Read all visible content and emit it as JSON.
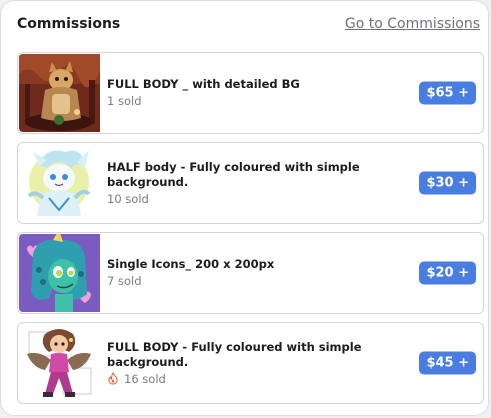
{
  "header": {
    "title": "Commissions",
    "link_label": "Go to Commissions"
  },
  "commissions": [
    {
      "name": "FULL BODY _ with detailed BG",
      "sold": "1 sold",
      "price": "$65 +",
      "hot": false
    },
    {
      "name": "HALF body - Fully coloured with simple background.",
      "sold": "10 sold",
      "price": "$30 +",
      "hot": false
    },
    {
      "name": "Single Icons_ 200 x 200px",
      "sold": "7 sold",
      "price": "$20 +",
      "hot": false
    },
    {
      "name": "FULL BODY - Fully coloured with simple background.",
      "sold": "16 sold",
      "price": "$45 +",
      "hot": true,
      "hot_icon": "fire-icon"
    }
  ],
  "colors": {
    "price_badge": "#4a7de0",
    "link": "#70707a"
  }
}
